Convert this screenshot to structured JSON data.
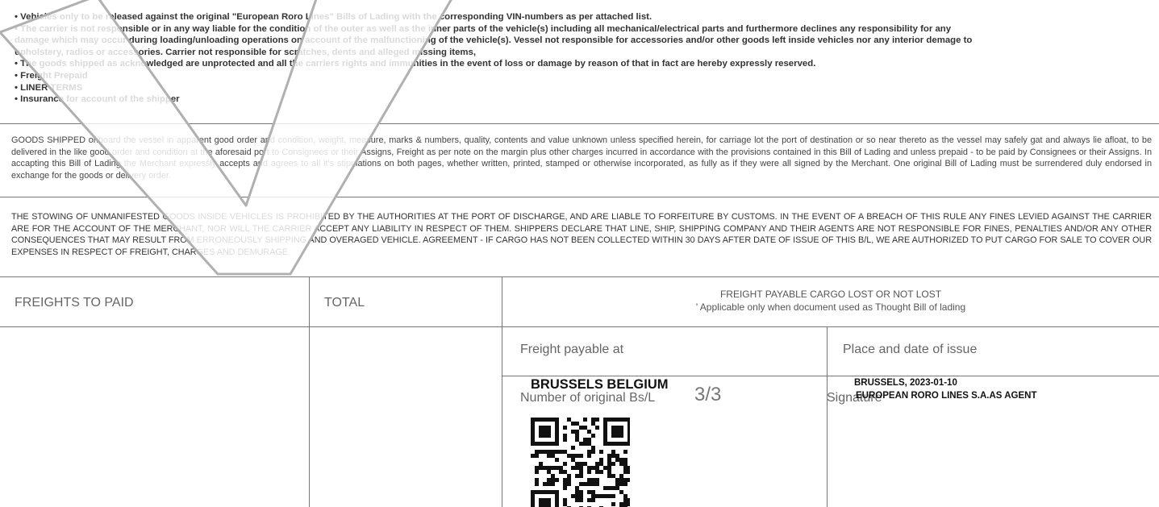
{
  "clauses": [
    "• Vehicles only to be released against the original \"European Roro Lines\" Bills of Lading with the corresponding VIN-numbers as per attached list.",
    "• The carrier is not responsible or in any way liable for the condition of the outer as well as the inner parts of the vehicle(s) including all mechanical/electrical parts and furthermore declines any responsibility for any",
    "  damage which may occur during loading/unloading operations on account of the malfunctioning of the vehicle(s). Vessel not responsible for accessories and/or other goods left inside vehicles nor any interior demage to",
    "  upholstery, radios or accessories. Carrier not responsible for scratches, dents and alleged missing items,",
    "• The goods shipped as acknowledged are unprotected and all the carriers rights and immunities in the event of loss or damage by reason of that in fact are hereby expressly reserved.",
    "• Freight Prepaid",
    "• LINER TERMS",
    "• Insurance for account of the shipper"
  ],
  "goods_shipped_text": "GOODS SHIPPED onboard the vessel in apparent good order and condition, weight, measure, marks & numbers, quality, contents and value unknown unless specified herein, for carriage lot the port of destination or so near thereto as the vessel may safely gat and always lie afloat, to be delivered in the like good order and condition at the aforesaid port to Consignees or their Assigns, Freight as per note on the margin plus other charges incurred in accordance with the provisions contained in this Bill of Lading and unless prepaid - to be paid by Consignees or their Assigns. In accapting this Bill of Lading the Merchant expressly accepts and agrees to all it's stipulations on both pages, whether written, printed, stamped or otherwise incorporated, as fully as if they were all signed by the Merchant. One original Bill of Lading must be surrendered duly endorsed in exchange for the goods or delivery order.",
  "stowing_text": "THE STOWING OF UNMANIFESTED GOODS INSIDE VEHICLES IS PROHIBITED BY THE AUTHORITIES AT THE PORT OF DISCHARGE, AND ARE LIABLE TO FORFEITURE BY CUSTOMS. IN THE EVENT OF A BREACH OF THIS RULE ANY FINES LEVIED AGAINST THE CARRIER ARE FOR THE ACCOUNT OF THE MERCHANT, NOR WILL THE CARRIER ACCEPT ANY LIABILITY IN RESPECT OF THEM. SHIPPERS DECLARE THAT LINE, SHIP, SHIPPING COMPANY AND THEIR AGENTS ARE NOT RESPONSIBLE FOR FINES, PENALTIES AND/OR ANY OTHER CONSEQUENCES THAT MAY RESULT FROM ERRONEOUSLY SHIPPING AND OVERAGED VEHICLE. AGREEMENT - IF CARGO HAS NOT BEEN COLLECTED WITHIN 30 DAYS AFTER DATE OF ISSUE OF THIS B/L, WE ARE AUTHORIZED TO PUT CARGO FOR SALE TO COVER OUR EXPENSES IN RESPECT OF FREIGHT, CHARGES AND DEMURAGE",
  "table": {
    "freights_label": "FREIGHTS TO PAID",
    "total_label": "TOTAL",
    "freight_notice": "FREIGHT PAYABLE CARGO LOST OR NOT LOST",
    "freight_notice_sub": "' Applicable only when document used as Thought Bill of lading",
    "freight_payable_at_label": "Freight payable at",
    "place_date_label": "Place and date of issue",
    "freight_payable_at_value": "BRUSSELS BELGIUM",
    "originals_label": "Number of original Bs/L",
    "originals_value": "3/3",
    "place_date_value": "BRUSSELS, 2023-01-10",
    "signature_label": "Signature",
    "signature_value": "EUROPEAN RORO LINES S.A.AS AGENT"
  },
  "watermark_icon": "checkmark-watermark-icon",
  "qr_icon": "qr-code-icon",
  "colors": {
    "rule": "#777777",
    "watermark": "#b0b0b0"
  }
}
